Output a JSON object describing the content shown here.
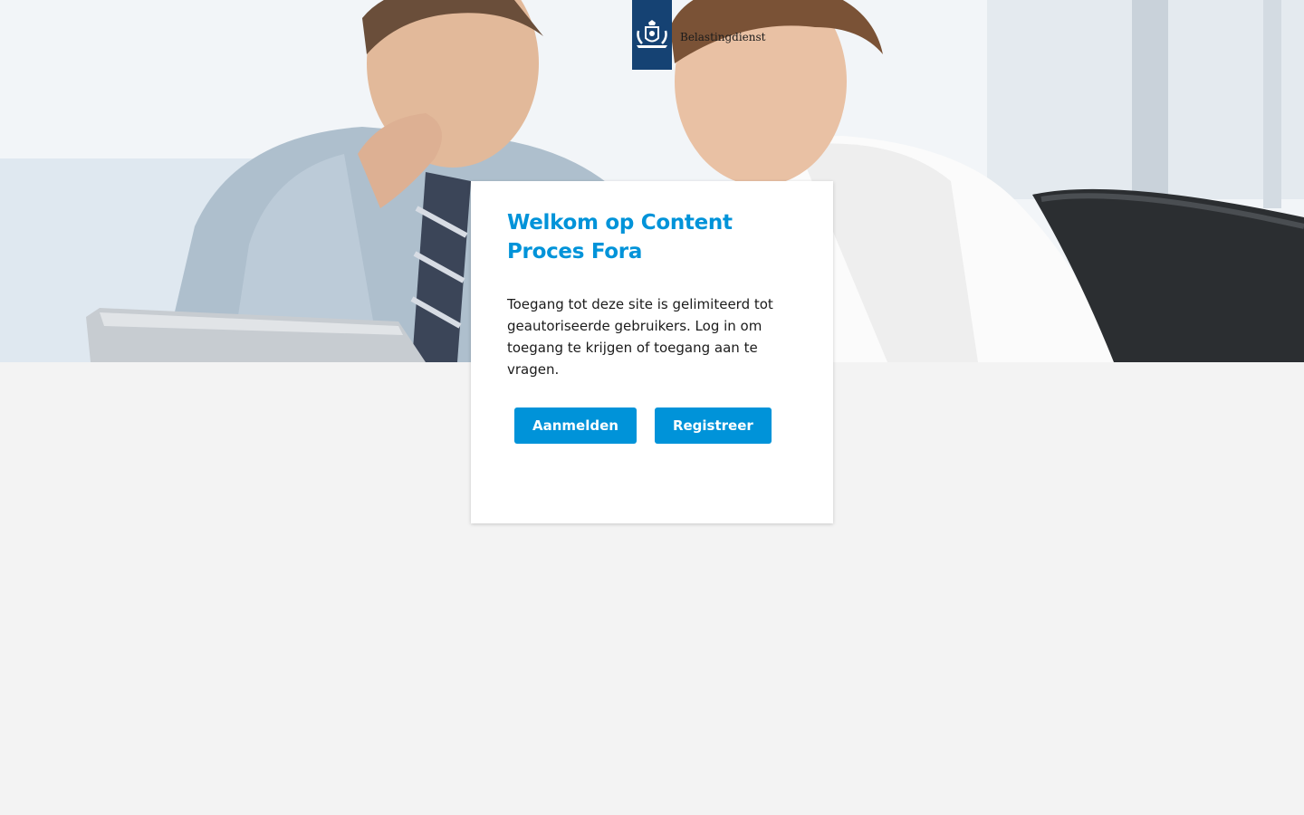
{
  "brand": {
    "name": "Belastingdienst",
    "ribbon_color": "#154273"
  },
  "hero": {
    "image_icon": "business-people-photo"
  },
  "card": {
    "title": "Welkom op Content Proces Fora",
    "text": "Toegang tot deze site is gelimiteerd tot geautoriseerde gebruikers. Log in om toegang te krijgen of toegang aan te vragen.",
    "login_label": "Aanmelden",
    "register_label": "Registreer"
  },
  "colors": {
    "accent": "#0093d9",
    "background": "#f3f3f3",
    "card": "#ffffff"
  }
}
